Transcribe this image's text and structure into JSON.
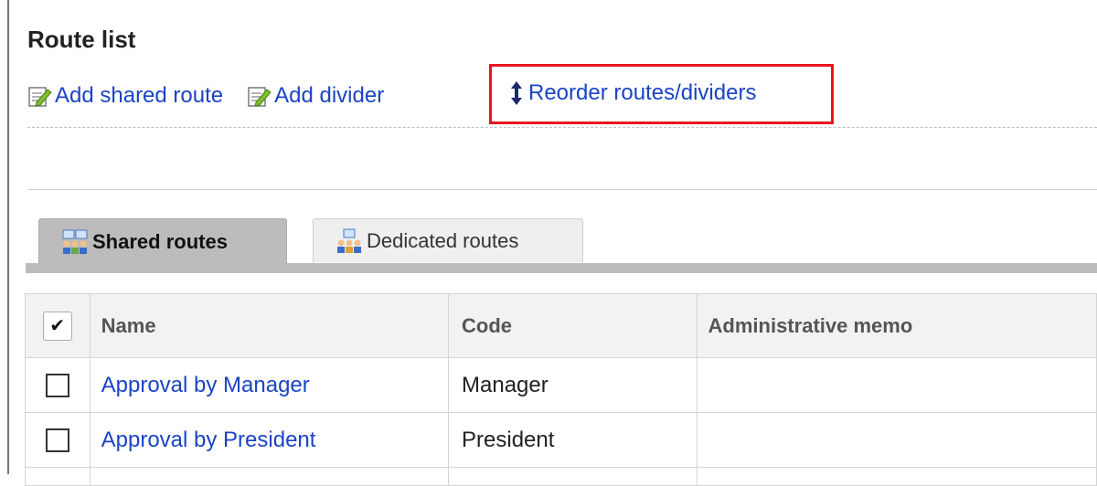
{
  "page": {
    "title": "Route list"
  },
  "actions": {
    "add_shared_route": "Add shared route",
    "add_divider": "Add divider",
    "reorder": "Reorder routes/dividers"
  },
  "icons": {
    "add_shared_route": "edit-note-icon",
    "add_divider": "edit-note-icon",
    "reorder": "up-down-arrow-icon",
    "shared_tab": "users-group-icon",
    "dedicated_tab": "users-group-icon"
  },
  "tabs": [
    {
      "label": "Shared routes",
      "selected": true
    },
    {
      "label": "Dedicated routes",
      "selected": false
    }
  ],
  "table": {
    "select_all_mark": "✔",
    "columns": [
      "Name",
      "Code",
      "Administrative memo"
    ],
    "rows": [
      {
        "name": "Approval by Manager",
        "code": "Manager",
        "memo": ""
      },
      {
        "name": "Approval by President",
        "code": "President",
        "memo": ""
      }
    ]
  },
  "colors": {
    "link": "#1a44c4",
    "highlight": "#e8161b",
    "tab_selected": "#bcbcbc",
    "tab_unselected": "#efefef"
  }
}
